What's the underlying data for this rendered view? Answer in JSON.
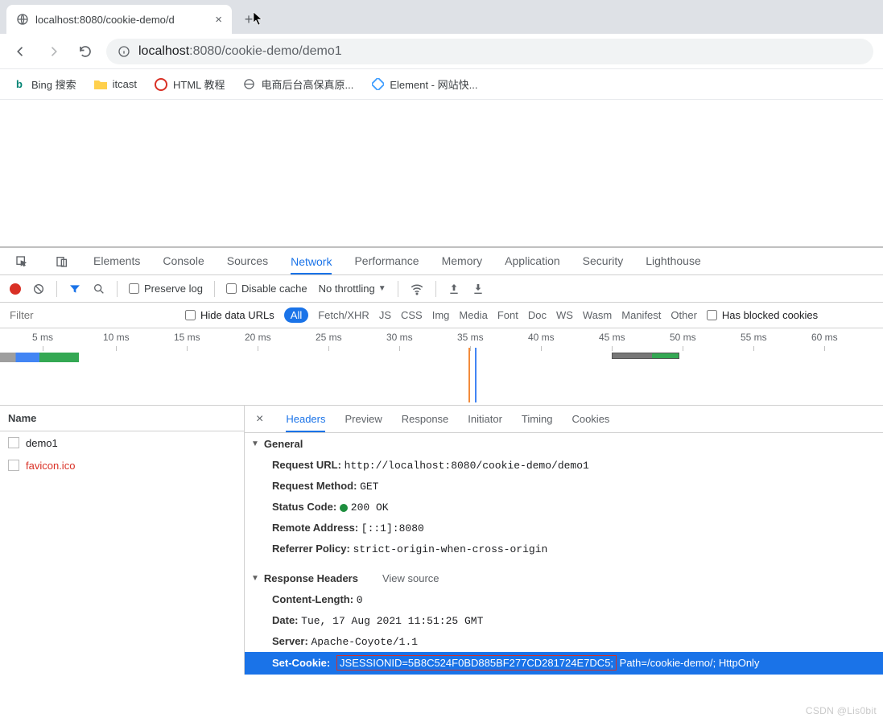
{
  "tab": {
    "title": "localhost:8080/cookie-demo/d"
  },
  "url": {
    "host": "localhost",
    "port": ":8080",
    "path": "/cookie-demo/demo1"
  },
  "bookmarks": [
    {
      "label": "Bing 搜索"
    },
    {
      "label": "itcast"
    },
    {
      "label": "HTML 教程"
    },
    {
      "label": "电商后台高保真原..."
    },
    {
      "label": "Element - 网站快..."
    }
  ],
  "devtools": {
    "tabs": [
      "Elements",
      "Console",
      "Sources",
      "Network",
      "Performance",
      "Memory",
      "Application",
      "Security",
      "Lighthouse"
    ],
    "active_tab": "Network",
    "toolbar": {
      "preserve": "Preserve log",
      "disable": "Disable cache",
      "throttle": "No throttling"
    },
    "filter": {
      "placeholder": "Filter",
      "hide_urls": "Hide data URLs",
      "all": "All",
      "types": [
        "Fetch/XHR",
        "JS",
        "CSS",
        "Img",
        "Media",
        "Font",
        "Doc",
        "WS",
        "Wasm",
        "Manifest",
        "Other"
      ],
      "blocked": "Has blocked cookies"
    },
    "timeline_ticks": [
      "5 ms",
      "10 ms",
      "15 ms",
      "20 ms",
      "25 ms",
      "30 ms",
      "35 ms",
      "40 ms",
      "45 ms",
      "50 ms",
      "55 ms",
      "60 ms"
    ],
    "name_header": "Name",
    "requests": [
      {
        "name": "demo1",
        "favicon": false
      },
      {
        "name": "favicon.ico",
        "favicon": true
      }
    ],
    "detail_tabs": [
      "Headers",
      "Preview",
      "Response",
      "Initiator",
      "Timing",
      "Cookies"
    ],
    "detail_active": "Headers",
    "general": {
      "title": "General",
      "req_url_k": "Request URL:",
      "req_url_v": "http://localhost:8080/cookie-demo/demo1",
      "req_method_k": "Request Method:",
      "req_method_v": "GET",
      "status_k": "Status Code:",
      "status_v": "200 OK",
      "remote_k": "Remote Address:",
      "remote_v": "[::1]:8080",
      "referrer_k": "Referrer Policy:",
      "referrer_v": "strict-origin-when-cross-origin"
    },
    "resp_headers": {
      "title": "Response Headers",
      "view_source": "View source",
      "clen_k": "Content-Length:",
      "clen_v": "0",
      "date_k": "Date:",
      "date_v": "Tue, 17 Aug 2021 11:51:25 GMT",
      "server_k": "Server:",
      "server_v": "Apache-Coyote/1.1",
      "cookie_k": "Set-Cookie:",
      "cookie_sess": "JSESSIONID=5B8C524F0BD885BF277CD281724E7DC5;",
      "cookie_rest": " Path=/cookie-demo/; HttpOnly"
    }
  },
  "watermark": "CSDN @Lis0bit"
}
